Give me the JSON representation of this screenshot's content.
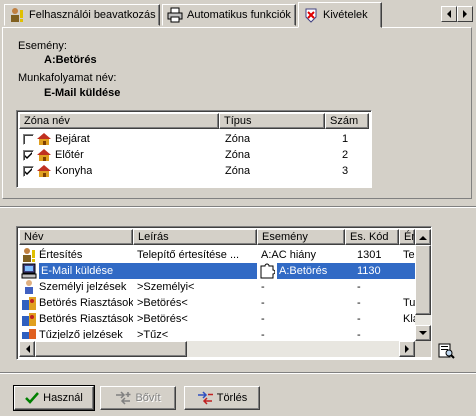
{
  "tabs": [
    {
      "label": "Felhasználói beavatkozás",
      "icon": "user-warning-icon"
    },
    {
      "label": "Automatikus funkciók",
      "icon": "printer-icon"
    },
    {
      "label": "Kivételek",
      "icon": "exceptions-icon"
    }
  ],
  "details": {
    "event_label": "Esemény:",
    "event_value": "A:Betörés",
    "workflow_label": "Munkafolyamat név:",
    "workflow_value": "E-Mail küldése"
  },
  "zones": {
    "columns": [
      "Zóna név",
      "Típus",
      "Szám"
    ],
    "rows": [
      {
        "name": "Bejárat",
        "type": "Zóna",
        "num": "1",
        "checked": false
      },
      {
        "name": "Előtér",
        "type": "Zóna",
        "num": "2",
        "checked": true
      },
      {
        "name": "Konyha",
        "type": "Zóna",
        "num": "3",
        "checked": true
      }
    ]
  },
  "workflows": {
    "columns": [
      "Név",
      "Leírás",
      "Esemény",
      "Es. Kód",
      "Ért"
    ],
    "rows": [
      {
        "name": "Értesítés",
        "desc": "Telepítő értesítése ...",
        "event": "A:AC hiány",
        "code": "1301",
        "extra": "Te"
      },
      {
        "name": "E-Mail küldése",
        "desc": "",
        "event": "A:Betörés",
        "code": "1130",
        "extra": ""
      },
      {
        "name": "Személyi jelzések",
        "desc": ">Személyi<",
        "event": "-",
        "code": "-",
        "extra": ""
      },
      {
        "name": "Betörés Riasztások",
        "desc": ">Betörés<",
        "event": "-",
        "code": "-",
        "extra": "Tu"
      },
      {
        "name": "Betörés Riasztások",
        "desc": ">Betörés<",
        "event": "-",
        "code": "-",
        "extra": "Klá"
      },
      {
        "name": "Tűzjelző jelzések",
        "desc": ">Tűz<",
        "event": "-",
        "code": "-",
        "extra": ""
      }
    ]
  },
  "buttons": {
    "use": "Használ",
    "expand": "Bővít",
    "delete": "Törlés"
  },
  "colors": {
    "selection": "#316ac5",
    "face": "#d4d0c8"
  }
}
